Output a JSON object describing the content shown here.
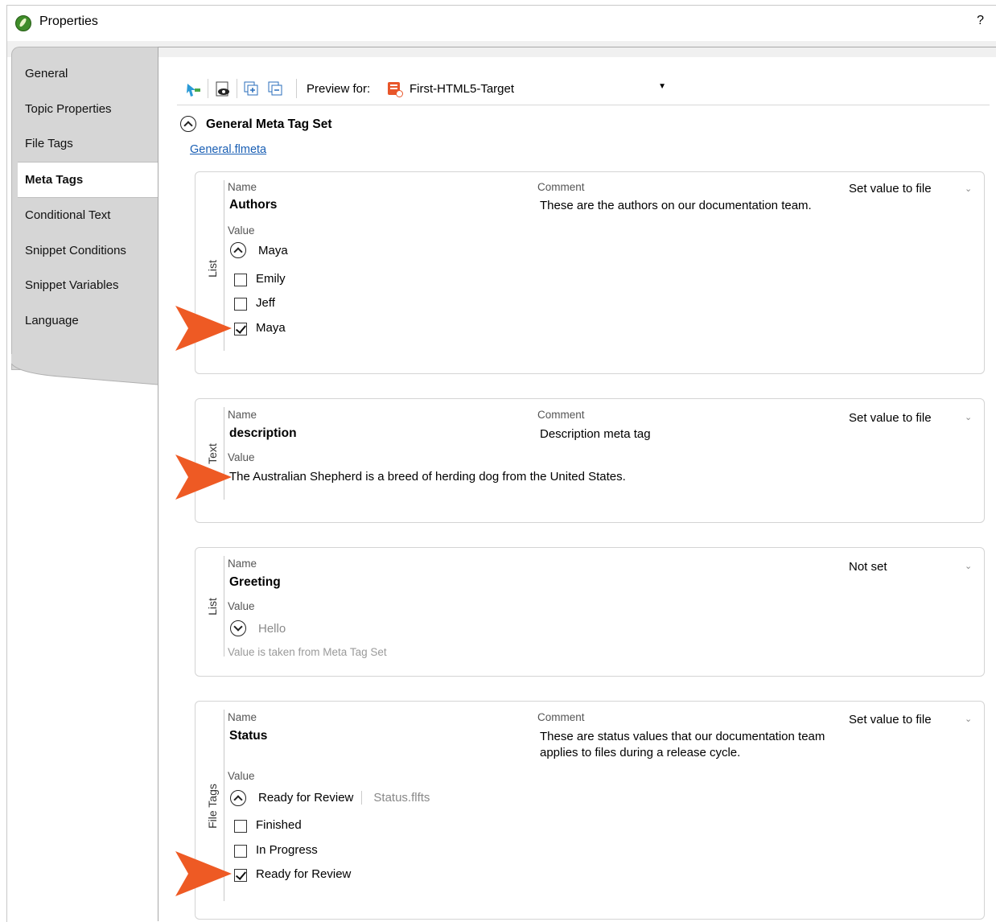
{
  "window": {
    "title": "Properties",
    "help_label": "?"
  },
  "sidebar": {
    "tabs": [
      {
        "label": "General"
      },
      {
        "label": "Topic Properties"
      },
      {
        "label": "File Tags"
      },
      {
        "label": "Meta Tags",
        "active": true
      },
      {
        "label": "Conditional Text"
      },
      {
        "label": "Snippet Conditions"
      },
      {
        "label": "Snippet Variables"
      },
      {
        "label": "Language"
      }
    ]
  },
  "toolbar": {
    "preview_label": "Preview for:",
    "preview_value": "First-HTML5-Target",
    "icons": [
      "apply-icon",
      "preview-eye-icon",
      "expand-all-icon",
      "collapse-all-icon"
    ]
  },
  "meta_tag_set": {
    "title": "General Meta Tag Set",
    "file_link": "General.flmeta"
  },
  "labels": {
    "name": "Name",
    "comment": "Comment",
    "value": "Value"
  },
  "cards": [
    {
      "type": "List",
      "name": "Authors",
      "comment": "These are the authors on our documentation team.",
      "setting": "Set value to file",
      "value": "Maya",
      "options": [
        {
          "label": "Emily",
          "checked": false
        },
        {
          "label": "Jeff",
          "checked": false
        },
        {
          "label": "Maya",
          "checked": true
        }
      ]
    },
    {
      "type": "Text",
      "name": "description",
      "comment": "Description meta tag",
      "setting": "Set value to file",
      "value": "The Australian Shepherd is a breed of herding dog from the United States."
    },
    {
      "type": "List",
      "name": "Greeting",
      "comment": "",
      "setting": "Not set",
      "value": "Hello",
      "note": "Value is taken from Meta Tag Set"
    },
    {
      "type": "File Tags",
      "name": "Status",
      "comment": "These are status values that our documentation team applies to files during a release cycle.",
      "setting": "Set value to file",
      "value": "Ready for Review",
      "file_ref": "Status.flfts",
      "options": [
        {
          "label": "Finished",
          "checked": false
        },
        {
          "label": "In Progress",
          "checked": false
        },
        {
          "label": "Ready for Review",
          "checked": true
        }
      ]
    }
  ],
  "colors": {
    "callout_arrow": "#ee5a24",
    "link": "#1a5fb4",
    "sidebar_bg": "#d6d6d6"
  }
}
